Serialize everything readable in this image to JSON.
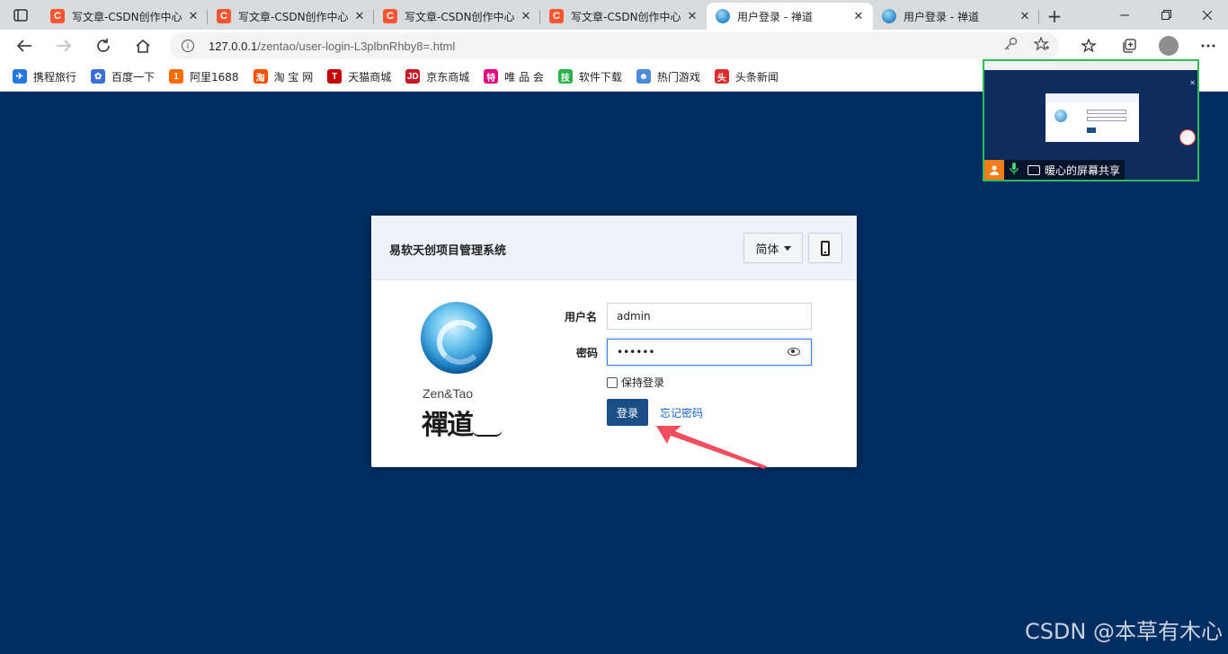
{
  "browser": {
    "tabs": [
      {
        "title": "写文章-CSDN创作中心",
        "favicon": "csdn-icon",
        "active": false
      },
      {
        "title": "写文章-CSDN创作中心",
        "favicon": "csdn-icon",
        "active": false
      },
      {
        "title": "写文章-CSDN创作中心",
        "favicon": "csdn-icon",
        "active": false
      },
      {
        "title": "写文章-CSDN创作中心",
        "favicon": "csdn-icon",
        "active": false
      },
      {
        "title": "用户登录 - 禅道",
        "favicon": "zentao-icon",
        "active": true
      },
      {
        "title": "用户登录 - 禅道",
        "favicon": "zentao-icon",
        "active": false
      }
    ],
    "favicon_csdn_letter": "C",
    "new_tab_glyph": "+",
    "close_glyph": "✕",
    "address": {
      "host": "127.0.0.1",
      "path": "/zentao/user-login-L3plbnRhby8=.html"
    },
    "bookmarks": [
      {
        "label": "携程旅行",
        "icon": "ctrip-icon",
        "color": "#2577e3",
        "glyph": "✈"
      },
      {
        "label": "百度一下",
        "icon": "baidu-icon",
        "color": "#3b6fd8",
        "glyph": "✿"
      },
      {
        "label": "阿里1688",
        "icon": "ali1688-icon",
        "color": "#ff6a00",
        "glyph": "1"
      },
      {
        "label": "淘 宝 网",
        "icon": "taobao-icon",
        "color": "#ff5000",
        "glyph": "淘"
      },
      {
        "label": "天猫商城",
        "icon": "tmall-icon",
        "color": "#c40000",
        "glyph": "T"
      },
      {
        "label": "京东商城",
        "icon": "jd-icon",
        "color": "#c91623",
        "glyph": "JD"
      },
      {
        "label": "唯 品 会",
        "icon": "vip-icon",
        "color": "#e4007f",
        "glyph": "特"
      },
      {
        "label": "软件下载",
        "icon": "software-icon",
        "color": "#27b24a",
        "glyph": "技"
      },
      {
        "label": "热门游戏",
        "icon": "game-icon",
        "color": "#4a8cd6",
        "glyph": "☻"
      },
      {
        "label": "头条新闻",
        "icon": "toutiao-icon",
        "color": "#e02b2b",
        "glyph": "头"
      }
    ]
  },
  "screen_share": {
    "label": "暖心的屏幕共享"
  },
  "login": {
    "title": "易软天创项目管理系统",
    "language": "简体",
    "brand_en": "Zen&Tao",
    "brand_cn": "禪道",
    "username_label": "用户名",
    "username_value": "admin",
    "password_label": "密码",
    "password_value": "••••••",
    "keep_login_label": "保持登录",
    "keep_login_checked": false,
    "submit_label": "登录",
    "forgot_label": "忘记密码"
  },
  "colors": {
    "page_background": "#002e63",
    "login_button": "#1a4e87",
    "arrow": "#f04e5e"
  },
  "watermark": "CSDN @本草有木心"
}
